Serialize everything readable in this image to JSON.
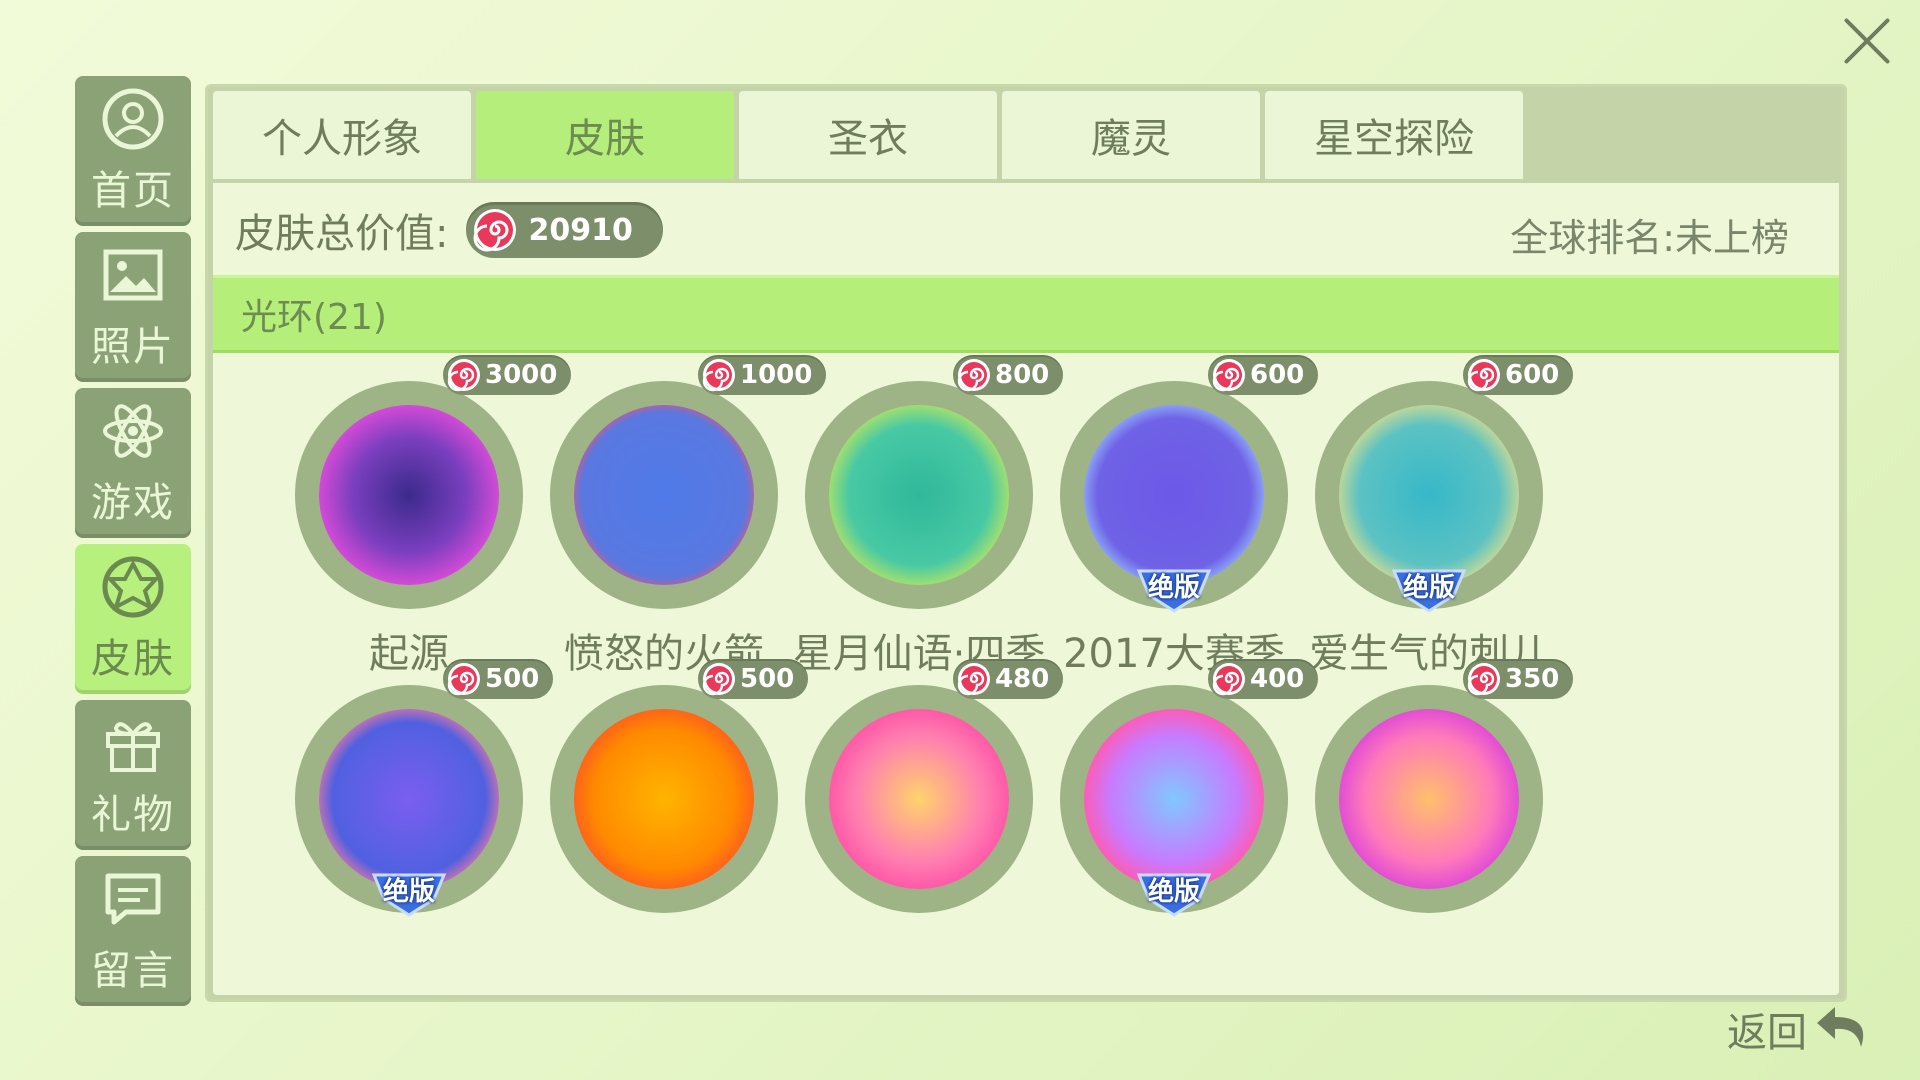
{
  "sidebar": {
    "items": [
      {
        "label": "首页",
        "icon": "user-icon"
      },
      {
        "label": "照片",
        "icon": "photo-icon"
      },
      {
        "label": "游戏",
        "icon": "atom-icon"
      },
      {
        "label": "皮肤",
        "icon": "skin-icon"
      },
      {
        "label": "礼物",
        "icon": "gift-icon"
      },
      {
        "label": "留言",
        "icon": "message-icon"
      }
    ],
    "active_index": 3
  },
  "tabs": [
    {
      "label": "个人形象"
    },
    {
      "label": "皮肤"
    },
    {
      "label": "圣衣"
    },
    {
      "label": "魔灵"
    },
    {
      "label": "星空探险"
    }
  ],
  "active_tab": 1,
  "summary": {
    "total_label": "皮肤总价值:",
    "total_value": "20910",
    "ranking": "全球排名:未上榜"
  },
  "category": {
    "label": "光环(21)"
  },
  "items": [
    {
      "name": "起源",
      "price": "3000",
      "badge": ""
    },
    {
      "name": "愤怒的火箭",
      "price": "1000",
      "badge": ""
    },
    {
      "name": "星月仙语·四季",
      "price": "800",
      "badge": ""
    },
    {
      "name": "2017大赛季",
      "price": "600",
      "badge": "绝版"
    },
    {
      "name": "爱生气的刺儿",
      "price": "600",
      "badge": "绝版"
    },
    {
      "name": "",
      "price": "500",
      "badge": "绝版"
    },
    {
      "name": "",
      "price": "500",
      "badge": ""
    },
    {
      "name": "",
      "price": "480",
      "badge": ""
    },
    {
      "name": "",
      "price": "400",
      "badge": "绝版"
    },
    {
      "name": "",
      "price": "350",
      "badge": ""
    }
  ],
  "back": {
    "label": "返回"
  },
  "colors": {
    "accent_green": "#b6ee7b",
    "sidebar_bg": "#8ba276",
    "coin_red": "#e8395b"
  }
}
